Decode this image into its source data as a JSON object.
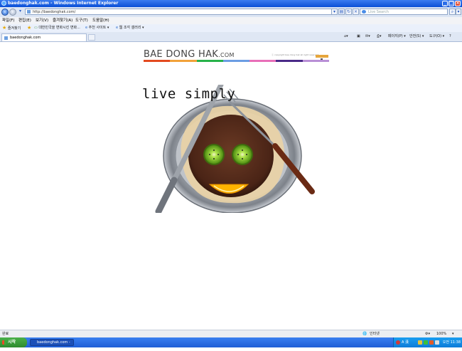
{
  "window": {
    "title": "baedonghak.com - Windows Internet Explorer"
  },
  "address_bar": {
    "url": "http://baedonghak.com/",
    "search_placeholder": "Live Search"
  },
  "menu": {
    "items": [
      "파일(F)",
      "편집(E)",
      "보기(V)",
      "즐겨찾기(A)",
      "도구(T)",
      "도움말(H)"
    ]
  },
  "favorites_bar": {
    "favorites_label": "즐겨찾기",
    "item1": "대한민국을 변화시킨 변화...",
    "item2": "추천 사이트 ▾",
    "item3": "웹 조각 갤러리 ▾"
  },
  "tabs": {
    "active_tab_label": "baedonghak.com"
  },
  "toolbar_right": {
    "page": "페이지(P) ▾",
    "safety": "안전(S) ▾",
    "tools": "도구(O) ▾",
    "help": "?"
  },
  "content": {
    "logo_main": "BAE DONG HAK",
    "logo_suffix": ".COM",
    "tagline": "ⓒ copyright bae dong hak all right reserved",
    "headline": "live simply",
    "color_bar": [
      "#e34a1f",
      "#f2a23a",
      "#27b24a",
      "#6b9de3",
      "#e86fb8",
      "#4a2a88",
      "#b98fd6"
    ]
  },
  "statusbar": {
    "status": "완료",
    "zone": "인터넷",
    "zoom": "100%"
  },
  "taskbar": {
    "start_label": "시작",
    "task_item": "baedonghak.com - ...",
    "ime": "A 漢",
    "clock": "오전 11:38"
  }
}
